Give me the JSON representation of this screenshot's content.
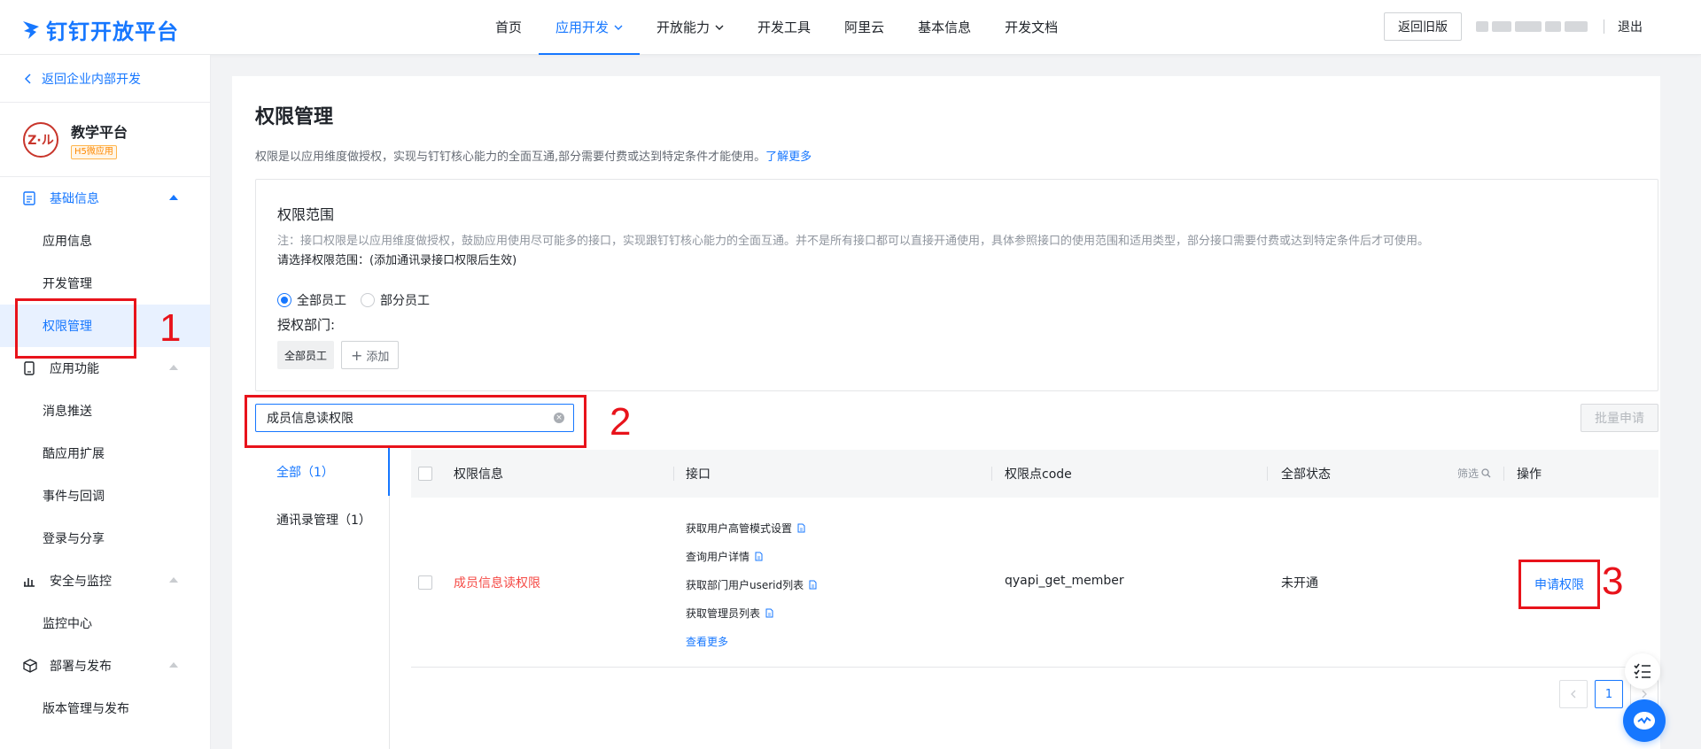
{
  "brand": {
    "name": "钉钉开放平台",
    "color": "#1677ff"
  },
  "nav": {
    "items": [
      {
        "label": "首页"
      },
      {
        "label": "应用开发",
        "active": true,
        "dropdown": true
      },
      {
        "label": "开放能力",
        "dropdown": true
      },
      {
        "label": "开发工具"
      },
      {
        "label": "阿里云"
      },
      {
        "label": "基本信息"
      },
      {
        "label": "开发文档"
      }
    ],
    "old_version": "返回旧版",
    "logout": "退出"
  },
  "sidebar": {
    "back": "返回企业内部开发",
    "app": {
      "name": "教学平台",
      "tag": "H5微应用",
      "logo_text": "Z·ル"
    },
    "groups": [
      {
        "label": "基础信息",
        "icon": "document-icon",
        "items": [
          "应用信息",
          "开发管理",
          "权限管理"
        ]
      },
      {
        "label": "应用功能",
        "icon": "phone-icon",
        "items": [
          "消息推送",
          "酷应用扩展",
          "事件与回调",
          "登录与分享"
        ]
      },
      {
        "label": "安全与监控",
        "icon": "bar-chart-icon",
        "items": [
          "监控中心"
        ]
      },
      {
        "label": "部署与发布",
        "icon": "cube-icon",
        "items": [
          "版本管理与发布"
        ]
      }
    ],
    "active_item": "权限管理"
  },
  "main": {
    "title": "权限管理",
    "desc": "权限是以应用维度做授权，实现与钉钉核心能力的全面互通,部分需要付费或达到特定条件才能使用。",
    "learn_more": "了解更多",
    "scope": {
      "title": "权限范围",
      "note": "注：接口权限是以应用维度做授权，鼓励应用使用尽可能多的接口，实现跟钉钉核心能力的全面互通。并不是所有接口都可以直接开通使用，具体参照接口的使用范围和适用类型，部分接口需要付费或达到特定条件后才可使用。",
      "sub": "请选择权限范围：(添加通讯录接口权限后生效)",
      "radio_all": "全部员工",
      "radio_part": "部分员工",
      "dept_label": "授权部门:",
      "dept_tag": "全部员工",
      "add": "添加"
    },
    "search_value": "成员信息读权限",
    "batch": "批量申请",
    "categories": [
      {
        "label": "全部（1）",
        "active": true
      },
      {
        "label": "通讯录管理（1）"
      }
    ],
    "table": {
      "columns": [
        "权限信息",
        "接口",
        "权限点code",
        "全部状态",
        "操作"
      ],
      "filter": "筛选",
      "rows": [
        {
          "name": "成员信息读权限",
          "apis": [
            "获取用户高管模式设置",
            "查询用户详情",
            "获取部门用户userid列表",
            "获取管理员列表"
          ],
          "more": "查看更多",
          "code": "qyapi_get_member",
          "status": "未开通",
          "action": "申请权限"
        }
      ]
    },
    "pager": {
      "current": "1"
    }
  },
  "annotations": [
    "1",
    "2",
    "3"
  ]
}
